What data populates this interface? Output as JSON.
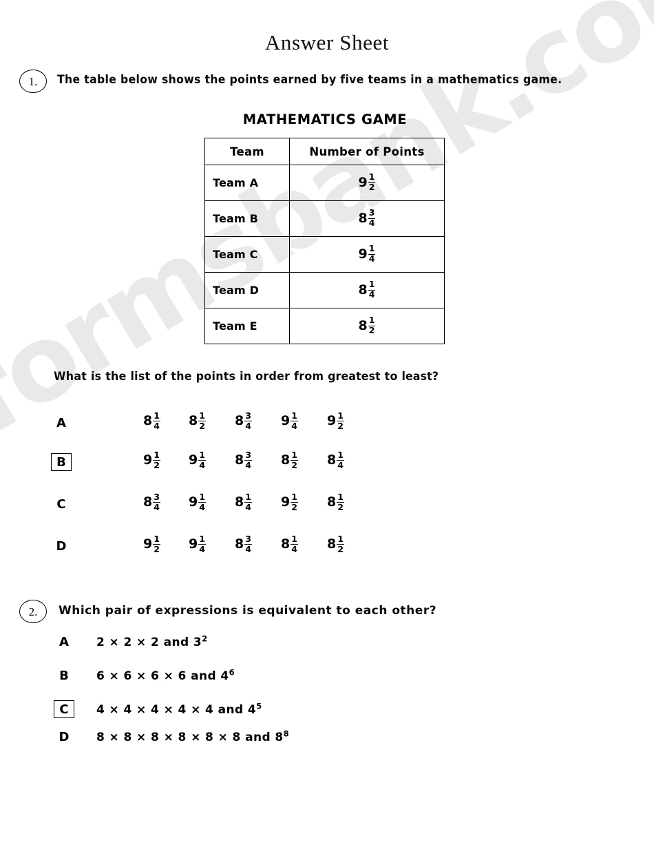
{
  "document": {
    "title": "Answer Sheet",
    "watermark": "formsbank.com",
    "watermark_color": "#e9e9e9"
  },
  "questions": [
    {
      "number": "1.",
      "stem": "The table below shows the points earned by five teams in a mathematics game.",
      "sub_prompt_pre": "What is the list of the points in order from ",
      "sub_prompt_emph1": "greatest",
      "sub_prompt_mid": " to ",
      "sub_prompt_emph2": "least",
      "sub_prompt_post": "?",
      "table": {
        "title": "MATHEMATICS GAME",
        "headers": [
          "Team",
          "Number of Points"
        ],
        "rows": [
          {
            "team": "Team A",
            "whole": "9",
            "num": "1",
            "den": "2"
          },
          {
            "team": "Team B",
            "whole": "8",
            "num": "3",
            "den": "4"
          },
          {
            "team": "Team C",
            "whole": "9",
            "num": "1",
            "den": "4"
          },
          {
            "team": "Team D",
            "whole": "8",
            "num": "1",
            "den": "4"
          },
          {
            "team": "Team E",
            "whole": "8",
            "num": "1",
            "den": "2"
          }
        ]
      },
      "options": [
        {
          "letter": "A",
          "selected": false,
          "values": [
            {
              "whole": "8",
              "num": "1",
              "den": "4"
            },
            {
              "whole": "8",
              "num": "1",
              "den": "2"
            },
            {
              "whole": "8",
              "num": "3",
              "den": "4"
            },
            {
              "whole": "9",
              "num": "1",
              "den": "4"
            },
            {
              "whole": "9",
              "num": "1",
              "den": "2"
            }
          ]
        },
        {
          "letter": "B",
          "selected": true,
          "values": [
            {
              "whole": "9",
              "num": "1",
              "den": "2"
            },
            {
              "whole": "9",
              "num": "1",
              "den": "4"
            },
            {
              "whole": "8",
              "num": "3",
              "den": "4"
            },
            {
              "whole": "8",
              "num": "1",
              "den": "2"
            },
            {
              "whole": "8",
              "num": "1",
              "den": "4"
            }
          ]
        },
        {
          "letter": "C",
          "selected": false,
          "values": [
            {
              "whole": "8",
              "num": "3",
              "den": "4"
            },
            {
              "whole": "9",
              "num": "1",
              "den": "4"
            },
            {
              "whole": "8",
              "num": "1",
              "den": "4"
            },
            {
              "whole": "9",
              "num": "1",
              "den": "2"
            },
            {
              "whole": "8",
              "num": "1",
              "den": "2"
            }
          ]
        },
        {
          "letter": "D",
          "selected": false,
          "values": [
            {
              "whole": "9",
              "num": "1",
              "den": "2"
            },
            {
              "whole": "9",
              "num": "1",
              "den": "4"
            },
            {
              "whole": "8",
              "num": "3",
              "den": "4"
            },
            {
              "whole": "8",
              "num": "1",
              "den": "4"
            },
            {
              "whole": "8",
              "num": "1",
              "den": "2"
            }
          ]
        }
      ]
    },
    {
      "number": "2.",
      "stem": "Which pair of expressions is equivalent to each other?",
      "options": [
        {
          "letter": "A",
          "selected": false,
          "base": "2 × 2 × 2 and 3",
          "exp": "2"
        },
        {
          "letter": "B",
          "selected": false,
          "base": "6 × 6 × 6 × 6 and 4",
          "exp": "6"
        },
        {
          "letter": "C",
          "selected": true,
          "base": "4 × 4 × 4 × 4 × 4 and 4",
          "exp": "5"
        },
        {
          "letter": "D",
          "selected": false,
          "base": "8 × 8 × 8 × 8 × 8 × 8 and 8",
          "exp": "8"
        }
      ]
    }
  ]
}
